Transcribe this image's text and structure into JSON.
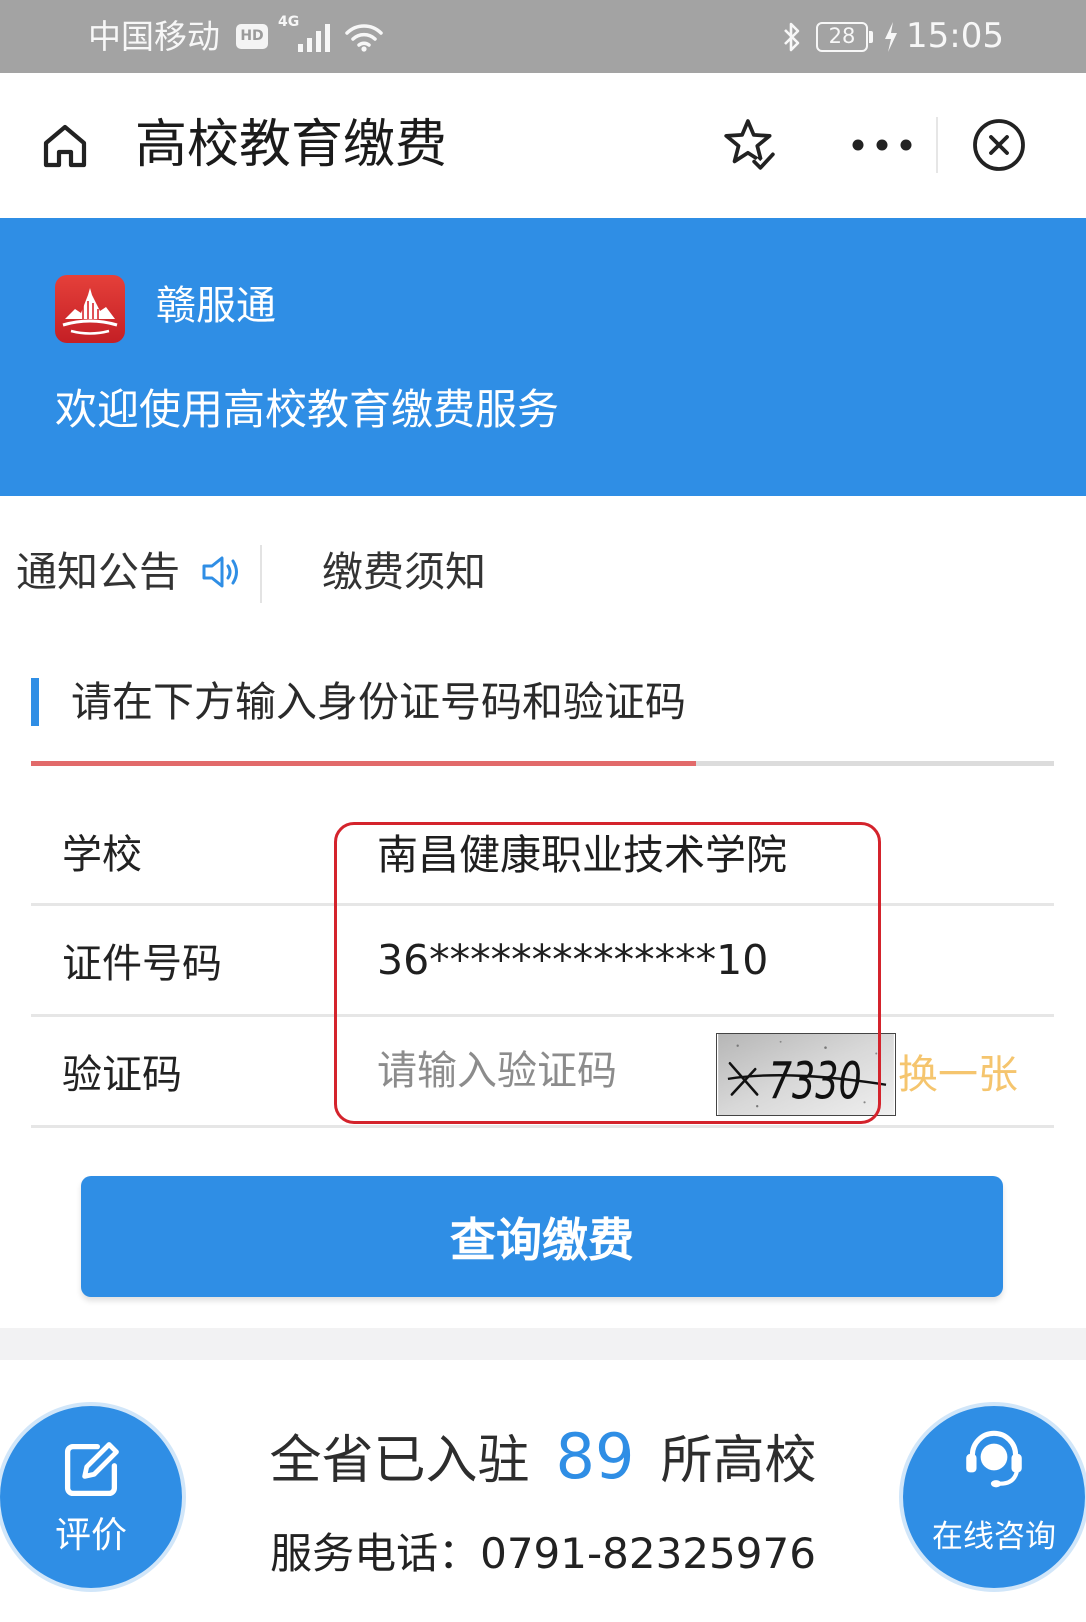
{
  "status_bar": {
    "carrier": "中国移动",
    "hd_badge": "HD",
    "network": "4G",
    "battery_level": "28",
    "time": "15:05",
    "icons": [
      "signal-icon",
      "wifi-icon",
      "bluetooth-icon",
      "charging-icon"
    ]
  },
  "header": {
    "title": "高校教育缴费",
    "icons": {
      "home": "home-icon",
      "favorite": "star-check-icon",
      "more": "more-dots-icon",
      "close": "close-circle-icon"
    }
  },
  "banner": {
    "logo": "ganfutong-logo",
    "app_name": "赣服通",
    "welcome": "欢迎使用高校教育缴费服务"
  },
  "tabs": [
    {
      "label": "通知公告",
      "icon": "speaker-icon"
    },
    {
      "label": "缴费须知"
    }
  ],
  "section": {
    "title": "请在下方输入身份证号码和验证码",
    "progress": 0.65
  },
  "form": {
    "school": {
      "label": "学校",
      "value": "南昌健康职业技术学院"
    },
    "id_number": {
      "label": "证件号码",
      "value": "36**************10"
    },
    "captcha": {
      "label": "验证码",
      "placeholder": "请输入验证码",
      "code": "7330",
      "refresh_label": "换一张"
    }
  },
  "submit": {
    "label": "查询缴费"
  },
  "footer": {
    "stats_prefix": "全省已入驻",
    "school_count": "89",
    "stats_suffix": "所高校",
    "phone_label": "服务电话：",
    "phone": "0791-82325976",
    "rate_button": {
      "label": "评价",
      "icon": "edit-icon"
    },
    "consult_button": {
      "label": "在线咨询",
      "icon": "headset-icon"
    }
  },
  "colors": {
    "accent": "#2f8ee5",
    "status_bar": "#a3a3a3",
    "highlight": "#d4232c",
    "progress_fill": "#e26a6a",
    "refresh_link": "#f5c56e",
    "logo_red": "#d8262c"
  }
}
